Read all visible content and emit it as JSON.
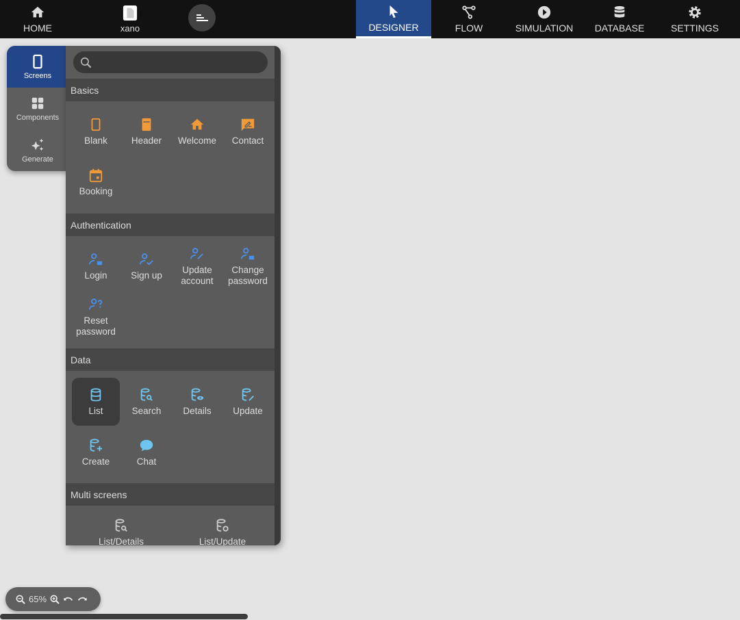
{
  "topbar": {
    "home": "HOME",
    "project": "xano",
    "tabs": [
      {
        "label": "DESIGNER",
        "icon": "cursor-icon"
      },
      {
        "label": "FLOW",
        "icon": "flow-icon"
      },
      {
        "label": "SIMULATION",
        "icon": "play-icon"
      },
      {
        "label": "DATABASE",
        "icon": "database-icon"
      },
      {
        "label": "SETTINGS",
        "icon": "gear-icon"
      }
    ]
  },
  "rail": [
    "Screens",
    "Components",
    "Generate"
  ],
  "search": {
    "placeholder": "",
    "value": ""
  },
  "sections": {
    "basics": {
      "title": "Basics",
      "items": [
        "Blank",
        "Header",
        "Welcome",
        "Contact",
        "Booking"
      ]
    },
    "auth": {
      "title": "Authentication",
      "items": [
        "Login",
        "Sign up",
        "Update account",
        "Change password",
        "Reset password"
      ]
    },
    "data": {
      "title": "Data",
      "items": [
        "List",
        "Search",
        "Details",
        "Update",
        "Create",
        "Chat"
      ]
    },
    "multi": {
      "title": "Multi screens",
      "items": [
        "List/Details",
        "List/Update"
      ]
    }
  },
  "zoom": {
    "level": "65%"
  },
  "colors": {
    "orange": "#f29a38",
    "blue": "#4a8fe8",
    "cyan": "#6ec6f0",
    "active": "#23498a"
  }
}
